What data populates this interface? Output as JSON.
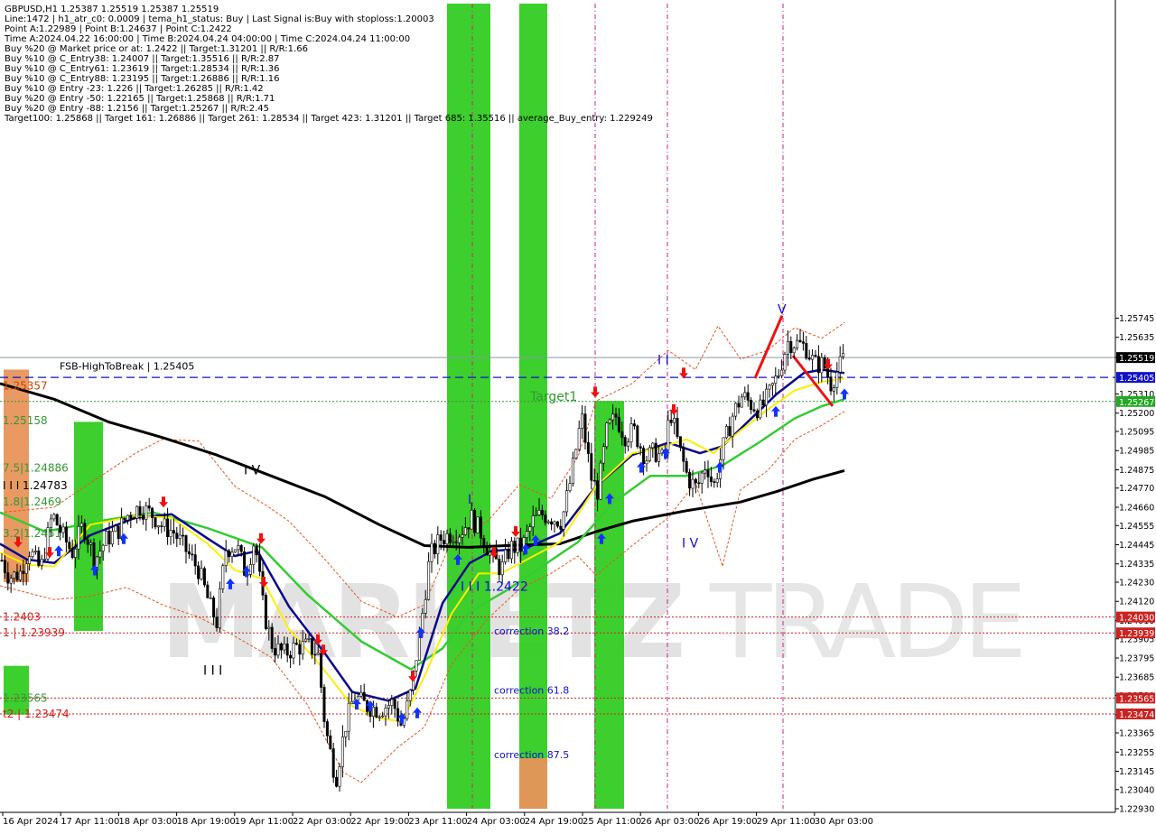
{
  "header": {
    "lines": [
      "GBPUSD,H1  1.25387 1.25519 1.25387 1.25519",
      "Line:1472 | h1_atr_c0: 0.0009 | tema_h1_status: Buy | Last Signal is:Buy with stoploss:1.20003",
      "Point A:1.22989 | Point B:1.24637 | Point C:1.2422",
      "Time A:2024.04.22 16:00:00 | Time B:2024.04.24 04:00:00 | Time C:2024.04.24 11:00:00",
      "Buy %20 @ Market price or at: 1.2422 || Target:1.31201 || R/R:1.66",
      "Buy %10 @ C_Entry38: 1.24007 || Target:1.35516 || R/R:2.87",
      "Buy %10 @ C_Entry61: 1.23619 || Target:1.28534 || R/R:1.36",
      "Buy %10 @ C_Entry88: 1.23195 || Target:1.26886 || R/R:1.16",
      "Buy %10 @ Entry -23: 1.226 || Target:1.26285 || R/R:1.42",
      "Buy %20 @ Entry -50: 1.22165 || Target:1.25868 || R/R:1.71",
      "Buy %20 @ Entry -88: 1.2156 || Target:1.25267 || R/R:2.45",
      "Target100: 1.25868 || Target 161: 1.26886 || Target 261: 1.28534 || Target 423: 1.31201 || Target 685: 1.35516 || average_Buy_entry: 1.229249"
    ]
  },
  "watermark": {
    "brand": "MARKETZ",
    "suffix": "TRADE"
  },
  "chart_data": {
    "type": "candlestick",
    "symbol": "GBPUSD",
    "timeframe": "H1",
    "ylim": [
      1.2293,
      1.2755
    ],
    "y_ticks": [
      "1.25745",
      "1.25635",
      "1.25520",
      "1.25310",
      "1.25200",
      "1.25095",
      "1.24985",
      "1.24875",
      "1.24770",
      "1.24660",
      "1.24555",
      "1.24445",
      "1.24335",
      "1.24230",
      "1.24120",
      "1.24010",
      "1.23905",
      "1.23795",
      "1.23685",
      "1.23580",
      "1.23470",
      "1.23365",
      "1.23255",
      "1.23145",
      "1.23040",
      "1.22930"
    ],
    "x_ticks": [
      "16 Apr 2024",
      "17 Apr 11:00",
      "18 Apr 03:00",
      "18 Apr 19:00",
      "19 Apr 11:00",
      "22 Apr 03:00",
      "22 Apr 19:00",
      "23 Apr 11:00",
      "24 Apr 03:00",
      "24 Apr 19:00",
      "25 Apr 11:00",
      "26 Apr 03:00",
      "26 Apr 19:00",
      "29 Apr 11:00",
      "30 Apr 03:00"
    ],
    "price_tags": [
      {
        "value": 1.25519,
        "label": "1.25519",
        "color": "#000000"
      },
      {
        "value": 1.25405,
        "label": "1.25405",
        "color": "#1111cc"
      },
      {
        "value": 1.25267,
        "label": "1.25267",
        "color": "#22aa22"
      },
      {
        "value": 1.2403,
        "label": "1.24030",
        "color": "#cc2222"
      },
      {
        "value": 1.23939,
        "label": "1.23939",
        "color": "#cc2222"
      },
      {
        "value": 1.23565,
        "label": "1.23565",
        "color": "#cc2222"
      },
      {
        "value": 1.23474,
        "label": "1.23474",
        "color": "#cc2222"
      }
    ],
    "level_labels": [
      {
        "text": "1.25357",
        "value": 1.25357,
        "color": "#cc4400"
      },
      {
        "text": "1.25158",
        "value": 1.25158,
        "color": "#339933"
      },
      {
        "text": "I I I 1.24783",
        "value": 1.24783,
        "color": "#000000"
      },
      {
        "text": "7.5|1.24886",
        "value": 1.24886,
        "color": "#339933"
      },
      {
        "text": "1.8|1.2469",
        "value": 1.2469,
        "color": "#339933"
      },
      {
        "text": "3.2|1.2451",
        "value": 1.2451,
        "color": "#339933"
      },
      {
        "text": "1.2403",
        "value": 1.2403,
        "color": "#cc2222"
      },
      {
        "text": "1 | 1.23939",
        "value": 1.23939,
        "color": "#cc2222"
      },
      {
        "text": "1.23565",
        "value": 1.23565,
        "color": "#339933"
      },
      {
        "text": "t2 | 1.23474",
        "value": 1.23474,
        "color": "#cc2222"
      }
    ],
    "annotations": [
      {
        "text": "Target1",
        "x": 587,
        "value": 1.2527,
        "color": "#339933"
      },
      {
        "text": "FSB-HighToBreak | 1.25405",
        "x": 66,
        "value": 1.2545,
        "color": "#000000"
      },
      {
        "text": "I I I 1.2422",
        "x": 510,
        "value": 1.2418,
        "color": "#1111cc"
      },
      {
        "text": "correction 38.2",
        "x": 547,
        "value": 1.2393,
        "color": "#1111cc"
      },
      {
        "text": "correction 61.8",
        "x": 547,
        "value": 1.2359,
        "color": "#1111cc"
      },
      {
        "text": "correction 87.5",
        "x": 547,
        "value": 1.2322,
        "color": "#1111cc"
      },
      {
        "text": "I V",
        "x": 270,
        "value": 1.2485,
        "color": "#000000"
      },
      {
        "text": "I I I",
        "x": 225,
        "value": 1.237,
        "color": "#000000"
      },
      {
        "text": "I I",
        "x": 728,
        "value": 1.2548,
        "color": "#1111cc"
      },
      {
        "text": "I",
        "x": 518,
        "value": 1.2468,
        "color": "#1111cc"
      },
      {
        "text": "I V",
        "x": 755,
        "value": 1.2443,
        "color": "#1111cc"
      },
      {
        "text": "V",
        "x": 861,
        "value": 1.2577,
        "color": "#1111cc"
      }
    ],
    "green_zones": [
      {
        "x0": 82,
        "x1": 114,
        "top": 1.2515,
        "bottom": 1.2395,
        "color": "#33cc22"
      },
      {
        "x0": 495,
        "x1": 543,
        "top": 1.2778,
        "bottom": 1.2293,
        "color": "#33cc22"
      },
      {
        "x0": 575,
        "x1": 606,
        "top": 1.2778,
        "bottom": 1.2293,
        "color": "#33cc22"
      },
      {
        "x0": 658,
        "x1": 691,
        "top": 1.2527,
        "bottom": 1.2293,
        "color": "#33cc22"
      },
      {
        "x0": 4,
        "x1": 32,
        "top": 1.2375,
        "bottom": 1.2347,
        "color": "#33cc22"
      }
    ],
    "orange_zones": [
      {
        "x0": 4,
        "x1": 32,
        "top": 1.2545,
        "bottom": 1.2423,
        "color": "#e8935a"
      },
      {
        "x0": 575,
        "x1": 606,
        "top": 1.2322,
        "bottom": 1.2293,
        "color": "#e8935a"
      }
    ],
    "vlines": [
      {
        "x": 523,
        "color": "#cc2288"
      },
      {
        "x": 659,
        "color": "#cc2288"
      },
      {
        "x": 739,
        "color": "#cc2288"
      },
      {
        "x": 867,
        "color": "#cc2288"
      }
    ],
    "ma_black": [
      [
        0,
        1.2537
      ],
      [
        60,
        1.2528
      ],
      [
        120,
        1.2515
      ],
      [
        180,
        1.2506
      ],
      [
        240,
        1.2496
      ],
      [
        300,
        1.2484
      ],
      [
        360,
        1.2472
      ],
      [
        420,
        1.2456
      ],
      [
        470,
        1.2444
      ],
      [
        520,
        1.2443
      ],
      [
        560,
        1.2444
      ],
      [
        620,
        1.2445
      ],
      [
        660,
        1.2452
      ],
      [
        700,
        1.2458
      ],
      [
        760,
        1.2464
      ],
      [
        820,
        1.2469
      ],
      [
        860,
        1.2475
      ],
      [
        900,
        1.2482
      ],
      [
        935,
        1.2487
      ]
    ],
    "ma_green": [
      [
        0,
        1.2463
      ],
      [
        50,
        1.2452
      ],
      [
        110,
        1.2458
      ],
      [
        170,
        1.2463
      ],
      [
        230,
        1.2454
      ],
      [
        290,
        1.2443
      ],
      [
        340,
        1.2416
      ],
      [
        400,
        1.2389
      ],
      [
        455,
        1.2373
      ],
      [
        490,
        1.2385
      ],
      [
        520,
        1.2406
      ],
      [
        560,
        1.2418
      ],
      [
        600,
        1.2432
      ],
      [
        640,
        1.2446
      ],
      [
        680,
        1.2469
      ],
      [
        720,
        1.2484
      ],
      [
        760,
        1.2484
      ],
      [
        800,
        1.249
      ],
      [
        840,
        1.2503
      ],
      [
        880,
        1.2517
      ],
      [
        910,
        1.2524
      ],
      [
        935,
        1.2528
      ]
    ],
    "ma_navy": [
      [
        0,
        1.2445
      ],
      [
        30,
        1.2436
      ],
      [
        60,
        1.2434
      ],
      [
        100,
        1.245
      ],
      [
        150,
        1.246
      ],
      [
        190,
        1.2462
      ],
      [
        230,
        1.2448
      ],
      [
        260,
        1.2438
      ],
      [
        285,
        1.2441
      ],
      [
        320,
        1.2409
      ],
      [
        360,
        1.2382
      ],
      [
        390,
        1.236
      ],
      [
        430,
        1.2355
      ],
      [
        460,
        1.2362
      ],
      [
        490,
        1.2411
      ],
      [
        520,
        1.2434
      ],
      [
        545,
        1.2441
      ],
      [
        580,
        1.2442
      ],
      [
        620,
        1.2451
      ],
      [
        660,
        1.2478
      ],
      [
        700,
        1.2496
      ],
      [
        740,
        1.2503
      ],
      [
        775,
        1.2497
      ],
      [
        800,
        1.2501
      ],
      [
        830,
        1.2516
      ],
      [
        860,
        1.2531
      ],
      [
        890,
        1.2543
      ],
      [
        910,
        1.2545
      ],
      [
        935,
        1.2543
      ]
    ],
    "ma_yellow": [
      [
        0,
        1.244
      ],
      [
        30,
        1.2433
      ],
      [
        60,
        1.2432
      ],
      [
        100,
        1.2456
      ],
      [
        150,
        1.2461
      ],
      [
        190,
        1.246
      ],
      [
        230,
        1.2445
      ],
      [
        260,
        1.243
      ],
      [
        290,
        1.2425
      ],
      [
        320,
        1.2396
      ],
      [
        360,
        1.2372
      ],
      [
        390,
        1.2352
      ],
      [
        420,
        1.2345
      ],
      [
        445,
        1.2343
      ],
      [
        470,
        1.2369
      ],
      [
        500,
        1.2405
      ],
      [
        530,
        1.2428
      ],
      [
        555,
        1.2428
      ],
      [
        580,
        1.2435
      ],
      [
        620,
        1.2446
      ],
      [
        660,
        1.2478
      ],
      [
        700,
        1.2497
      ],
      [
        730,
        1.25
      ],
      [
        760,
        1.2505
      ],
      [
        790,
        1.2497
      ],
      [
        820,
        1.251
      ],
      [
        850,
        1.2522
      ],
      [
        880,
        1.2533
      ],
      [
        910,
        1.2538
      ],
      [
        935,
        1.254
      ]
    ],
    "env_upper": [
      [
        0,
        1.2463
      ],
      [
        60,
        1.2466
      ],
      [
        100,
        1.248
      ],
      [
        150,
        1.2497
      ],
      [
        180,
        1.2505
      ],
      [
        220,
        1.2504
      ],
      [
        260,
        1.2478
      ],
      [
        295,
        1.2467
      ],
      [
        320,
        1.2458
      ],
      [
        360,
        1.2436
      ],
      [
        400,
        1.2412
      ],
      [
        440,
        1.2403
      ],
      [
        470,
        1.241
      ],
      [
        500,
        1.2447
      ],
      [
        540,
        1.2458
      ],
      [
        575,
        1.2479
      ],
      [
        610,
        1.2471
      ],
      [
        640,
        1.2495
      ],
      [
        660,
        1.2527
      ],
      [
        700,
        1.2537
      ],
      [
        740,
        1.2556
      ],
      [
        770,
        1.2545
      ],
      [
        795,
        1.257
      ],
      [
        820,
        1.2551
      ],
      [
        850,
        1.2556
      ],
      [
        880,
        1.2569
      ],
      [
        910,
        1.2563
      ],
      [
        935,
        1.2572
      ]
    ],
    "env_lower": [
      [
        0,
        1.2421
      ],
      [
        60,
        1.2413
      ],
      [
        100,
        1.2415
      ],
      [
        140,
        1.242
      ],
      [
        180,
        1.241
      ],
      [
        220,
        1.2403
      ],
      [
        260,
        1.2392
      ],
      [
        300,
        1.238
      ],
      [
        340,
        1.2353
      ],
      [
        380,
        1.2314
      ],
      [
        400,
        1.2308
      ],
      [
        440,
        1.2328
      ],
      [
        470,
        1.234
      ],
      [
        500,
        1.2376
      ],
      [
        540,
        1.2402
      ],
      [
        575,
        1.2419
      ],
      [
        610,
        1.2428
      ],
      [
        640,
        1.2438
      ],
      [
        660,
        1.2427
      ],
      [
        700,
        1.2444
      ],
      [
        740,
        1.246
      ],
      [
        770,
        1.248
      ],
      [
        800,
        1.2432
      ],
      [
        820,
        1.2476
      ],
      [
        850,
        1.2487
      ],
      [
        880,
        1.2505
      ],
      [
        910,
        1.2513
      ],
      [
        935,
        1.2521
      ]
    ],
    "red_lines": [
      [
        [
          836,
          1.254
        ],
        [
          866,
          1.2576
        ]
      ],
      [
        [
          878,
          1.2553
        ],
        [
          922,
          1.2524
        ]
      ]
    ],
    "up_arrows": [
      [
        65,
        1.2441
      ],
      [
        105,
        1.243
      ],
      [
        137,
        1.2448
      ],
      [
        255,
        1.2422
      ],
      [
        273,
        1.2429
      ],
      [
        395,
        1.2353
      ],
      [
        410,
        1.2352
      ],
      [
        445,
        1.2345
      ],
      [
        462,
        1.2348
      ],
      [
        466,
        1.2394
      ],
      [
        507,
        1.2436
      ],
      [
        582,
        1.2442
      ],
      [
        593,
        1.2447
      ],
      [
        666,
        1.2448
      ],
      [
        675,
        1.2471
      ],
      [
        710,
        1.2489
      ],
      [
        737,
        1.2497
      ],
      [
        797,
        1.2489
      ],
      [
        859,
        1.2521
      ],
      [
        935,
        1.2531
      ]
    ],
    "down_arrows": [
      [
        20,
        1.2446
      ],
      [
        55,
        1.244
      ],
      [
        181,
        1.2469
      ],
      [
        289,
        1.2448
      ],
      [
        292,
        1.2423
      ],
      [
        352,
        1.239
      ],
      [
        358,
        1.2384
      ],
      [
        457,
        1.2369
      ],
      [
        547,
        1.244
      ],
      [
        571,
        1.2452
      ],
      [
        659,
        1.2532
      ],
      [
        746,
        1.2522
      ],
      [
        757,
        1.2543
      ],
      [
        917,
        1.2548
      ]
    ],
    "dashed_lines": [
      {
        "value": 1.25405,
        "color": "#1111cc",
        "style": "dash"
      },
      {
        "value": 1.25267,
        "color": "#339933",
        "style": "dot"
      },
      {
        "value": 1.2403,
        "color": "#cc2222",
        "style": "dot"
      },
      {
        "value": 1.23939,
        "color": "#cc2222",
        "style": "dot"
      },
      {
        "value": 1.23565,
        "color": "#cc2222",
        "style": "dot"
      },
      {
        "value": 1.23474,
        "color": "#cc2222",
        "style": "dot"
      },
      {
        "value": 1.25519,
        "color": "#8899aa",
        "style": "solid"
      }
    ],
    "candle_path": [
      [
        0,
        1.2438
      ],
      [
        10,
        1.2426
      ],
      [
        22,
        1.2428
      ],
      [
        32,
        1.2442
      ],
      [
        45,
        1.243
      ],
      [
        58,
        1.2462
      ],
      [
        68,
        1.2451
      ],
      [
        80,
        1.244
      ],
      [
        92,
        1.2456
      ],
      [
        105,
        1.2436
      ],
      [
        118,
        1.2448
      ],
      [
        130,
        1.2452
      ],
      [
        142,
        1.2462
      ],
      [
        155,
        1.2466
      ],
      [
        168,
        1.2462
      ],
      [
        180,
        1.2455
      ],
      [
        192,
        1.2452
      ],
      [
        205,
        1.2442
      ],
      [
        220,
        1.243
      ],
      [
        232,
        1.241
      ],
      [
        240,
        1.24
      ],
      [
        250,
        1.2442
      ],
      [
        262,
        1.2444
      ],
      [
        272,
        1.2428
      ],
      [
        282,
        1.2448
      ],
      [
        292,
        1.2406
      ],
      [
        302,
        1.2386
      ],
      [
        315,
        1.2382
      ],
      [
        328,
        1.2386
      ],
      [
        342,
        1.2386
      ],
      [
        352,
        1.2382
      ],
      [
        360,
        1.234
      ],
      [
        372,
        1.231
      ],
      [
        382,
        1.234
      ],
      [
        392,
        1.2358
      ],
      [
        405,
        1.2352
      ],
      [
        420,
        1.235
      ],
      [
        435,
        1.2354
      ],
      [
        445,
        1.234
      ],
      [
        455,
        1.236
      ],
      [
        466,
        1.2398
      ],
      [
        476,
        1.2438
      ],
      [
        488,
        1.2448
      ],
      [
        500,
        1.2451
      ],
      [
        510,
        1.2452
      ],
      [
        522,
        1.246
      ],
      [
        532,
        1.2452
      ],
      [
        542,
        1.244
      ],
      [
        555,
        1.243
      ],
      [
        565,
        1.2443
      ],
      [
        578,
        1.2443
      ],
      [
        590,
        1.2458
      ],
      [
        600,
        1.2462
      ],
      [
        612,
        1.246
      ],
      [
        622,
        1.2458
      ],
      [
        632,
        1.2482
      ],
      [
        644,
        1.2518
      ],
      [
        655,
        1.2482
      ],
      [
        662,
        1.2475
      ],
      [
        672,
        1.251
      ],
      [
        682,
        1.2518
      ],
      [
        692,
        1.2507
      ],
      [
        702,
        1.251
      ],
      [
        715,
        1.2494
      ],
      [
        725,
        1.2498
      ],
      [
        735,
        1.2493
      ],
      [
        742,
        1.2522
      ],
      [
        752,
        1.25
      ],
      [
        762,
        1.2482
      ],
      [
        772,
        1.2477
      ],
      [
        782,
        1.2492
      ],
      [
        790,
        1.2477
      ],
      [
        800,
        1.2499
      ],
      [
        812,
        1.252
      ],
      [
        822,
        1.253
      ],
      [
        832,
        1.2525
      ],
      [
        842,
        1.2522
      ],
      [
        852,
        1.2531
      ],
      [
        862,
        1.2543
      ],
      [
        872,
        1.2561
      ],
      [
        882,
        1.256
      ],
      [
        892,
        1.2558
      ],
      [
        902,
        1.2548
      ],
      [
        912,
        1.2548
      ],
      [
        920,
        1.2537
      ],
      [
        928,
        1.2545
      ],
      [
        935,
        1.2552
      ]
    ]
  }
}
